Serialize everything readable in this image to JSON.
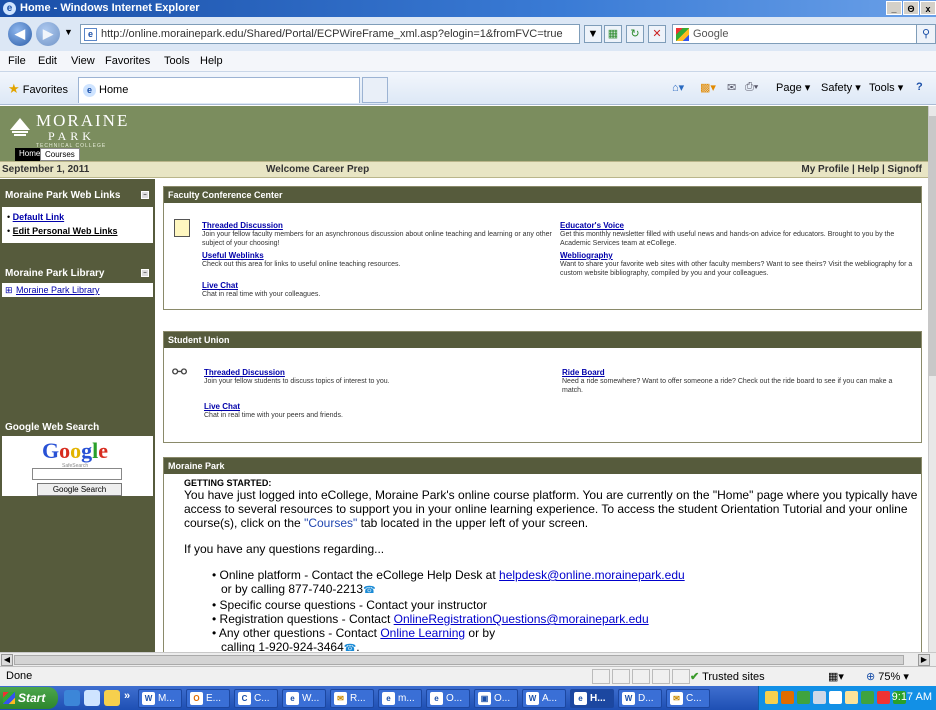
{
  "window": {
    "title": "Home - Windows Internet Explorer",
    "controls": [
      "_",
      "Θ",
      "x"
    ]
  },
  "address_bar": {
    "url": "http://online.morainepark.edu/Shared/Portal/ECPWireFrame_xml.asp?elogin=1&fromFVC=true",
    "search_placeholder": "Google"
  },
  "menu": [
    "File",
    "Edit",
    "View",
    "Favorites",
    "Tools",
    "Help"
  ],
  "favorites_bar": {
    "favorites_label": "Favorites",
    "tab_label": "Home",
    "commands": [
      "Page ▾",
      "Safety ▾",
      "Tools ▾"
    ]
  },
  "site": {
    "logo_name": "MORAINE",
    "logo_sub": "PARK",
    "logo_tag": "TECHNICAL COLLEGE",
    "tabs": [
      "Home",
      "Courses"
    ],
    "date": "September 1, 2011",
    "welcome": "Welcome Career Prep",
    "top_links": "My Profile  |  Help  |  Signoff"
  },
  "sidebar": {
    "web_links": {
      "title": "Moraine Park Web Links",
      "items": [
        "Default Link",
        "Edit Personal Web Links"
      ]
    },
    "library": {
      "title": "Moraine Park Library",
      "item": "Moraine Park Library"
    },
    "google": {
      "title": "Google Web Search",
      "safe": "SafeSearch",
      "button": "Google Search"
    }
  },
  "faculty": {
    "title": "Faculty Conference Center",
    "items": [
      {
        "link": "Threaded Discussion",
        "desc": "Join your fellow faculty members for an asynchronous discussion about online teaching and learning or any other subject of your choosing!"
      },
      {
        "link": "Useful Weblinks",
        "desc": "Check out this area for links to useful online teaching resources."
      },
      {
        "link": "Live Chat",
        "desc": "Chat in real time with your colleagues."
      },
      {
        "link": "Educator's Voice",
        "desc": "Get this monthly newsletter filled with useful news and hands-on advice for educators. Brought to you by the Academic Services team at eCollege."
      },
      {
        "link": "Webliography",
        "desc": "Want to share your favorite web sites with other faculty members? Want to see theirs? Visit the webliography for a custom website bibliography, compiled by you and your colleagues."
      }
    ]
  },
  "student_union": {
    "title": "Student Union",
    "items": [
      {
        "link": "Threaded Discussion",
        "desc": "Join your fellow students to discuss topics of interest to you."
      },
      {
        "link": "Live Chat",
        "desc": "Chat in real time with your peers and friends."
      },
      {
        "link": "Ride Board",
        "desc": "Need a ride somewhere? Want to offer someone a ride? Check out the ride board to see if you can make a match."
      }
    ]
  },
  "moraine_park": {
    "title": "Moraine Park",
    "heading": "GETTING STARTED:",
    "para1": "You have just logged into eCollege, Moraine Park's online course platform.  You are currently on the \"Home\" page where you typically have access to several resources to support you in your online learning experience.  To access the student Orientation Tutorial and your online course(s), click on the",
    "courses_word": "\"Courses\"",
    "para1_end": "tab located in the upper left of your screen.",
    "questions": "If you have any questions regarding...",
    "b1_a": "Online platform - Contact the eCollege Help Desk at",
    "b1_link": "helpdesk@online.morainepark.edu",
    "b1_b": "or by calling 877-740-2213",
    "b2": "Specific course questions - Contact your instructor",
    "b3_a": "Registration questions - Contact",
    "b3_link": "OnlineRegistrationQuestions@morainepark.edu",
    "b4_a": "Any other questions - Contact",
    "b4_link": "Online Learning",
    "b4_b": "or by",
    "b4_c": "calling 1-920-924-3464"
  },
  "status_bar": {
    "done": "Done",
    "zone": "Trusted sites",
    "zoom": "75%"
  },
  "taskbar": {
    "start": "Start",
    "buttons": [
      {
        "icon": "W",
        "label": "M..."
      },
      {
        "icon": "O",
        "label": "E..."
      },
      {
        "icon": "C",
        "label": "C..."
      },
      {
        "icon": "e",
        "label": "W..."
      },
      {
        "icon": "✉",
        "label": "R..."
      },
      {
        "icon": "e",
        "label": "m..."
      },
      {
        "icon": "e",
        "label": "O..."
      },
      {
        "icon": "▣",
        "label": "O..."
      },
      {
        "icon": "W",
        "label": "A..."
      },
      {
        "icon": "e",
        "label": "H..."
      },
      {
        "icon": "W",
        "label": "D..."
      },
      {
        "icon": "✉",
        "label": "C..."
      }
    ],
    "clock": "9:17 AM"
  }
}
